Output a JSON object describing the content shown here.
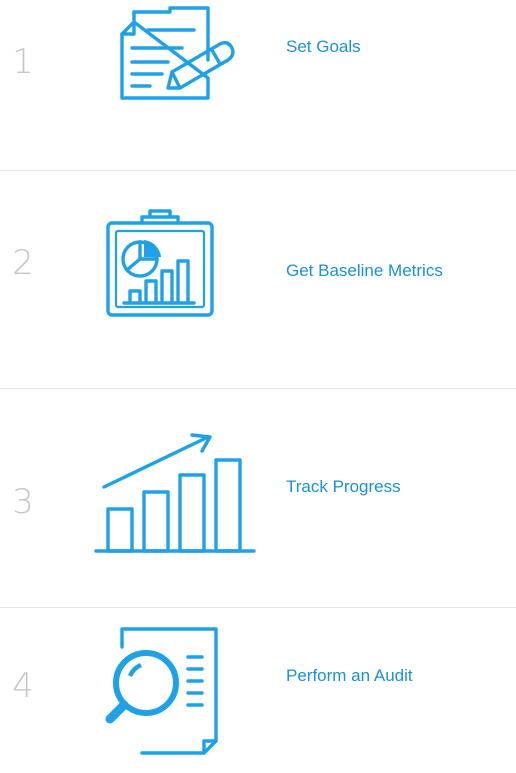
{
  "accent_color": "#1ea1e6",
  "steps": [
    {
      "number": "1",
      "label": "Set Goals",
      "icon": "document-pencil-icon"
    },
    {
      "number": "2",
      "label": "Get Baseline Metrics",
      "icon": "clipboard-chart-icon"
    },
    {
      "number": "3",
      "label": "Track Progress",
      "icon": "growth-bar-chart-icon"
    },
    {
      "number": "4",
      "label": "Perform an Audit",
      "icon": "magnifier-document-icon"
    }
  ]
}
